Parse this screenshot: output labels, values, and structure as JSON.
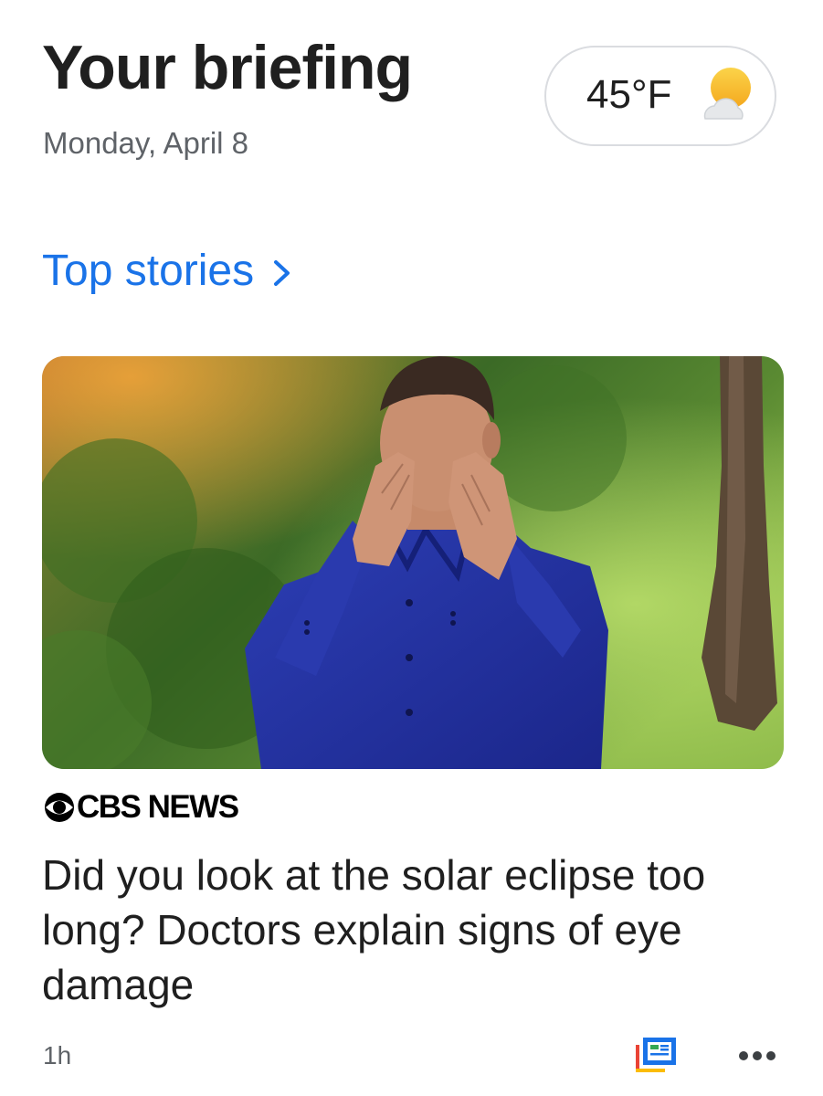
{
  "header": {
    "title": "Your briefing",
    "date": "Monday, April 8"
  },
  "weather": {
    "temperature": "45°F",
    "icon": "partly-sunny-icon"
  },
  "section": {
    "title": "Top stories"
  },
  "story": {
    "source": "CBS NEWS",
    "headline": "Did you look at the solar eclipse too long? Doctors explain signs of eye damage",
    "time": "1h"
  },
  "colors": {
    "accent": "#1a73e8",
    "text": "#1f1f1f",
    "secondary_text": "#5f6368"
  }
}
